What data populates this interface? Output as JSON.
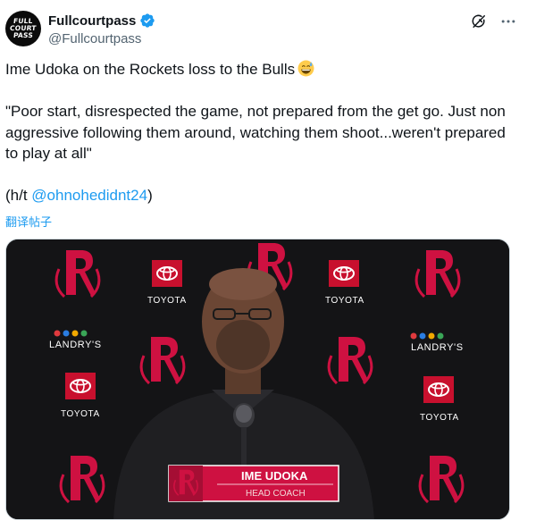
{
  "tweet": {
    "author": {
      "display_name": "Fullcourtpass",
      "handle": "@Fullcourtpass",
      "avatar_lines": [
        "FULL",
        "COURT",
        "PASS"
      ],
      "verified": true
    },
    "text_line1": "Ime Udoka on the Rockets loss to the Bulls",
    "quote": "\"Poor start, disrespected the game, not prepared from the get go. Just non aggressive following them around, watching them shoot...weren't prepared to play at all\"",
    "hat_tip_prefix": "(h/t ",
    "hat_tip_mention": "@ohnohedidnt24",
    "hat_tip_suffix": ")",
    "translate_label": "翻译帖子",
    "emoji": "grinning-face-with-sweat"
  },
  "media": {
    "nameplate": {
      "name": "IME UDOKA",
      "title": "HEAD COACH"
    },
    "backdrop_sponsors": {
      "toyota": "TOYOTA",
      "landrys": "LANDRY'S"
    },
    "colors": {
      "rockets_red": "#ce1141",
      "backdrop": "#141416"
    }
  },
  "icons": {
    "header_right": [
      "grok-icon",
      "more-icon"
    ]
  },
  "colors": {
    "link": "#1d9bf0",
    "secondary_text": "#536471",
    "primary_text": "#0f1419"
  }
}
